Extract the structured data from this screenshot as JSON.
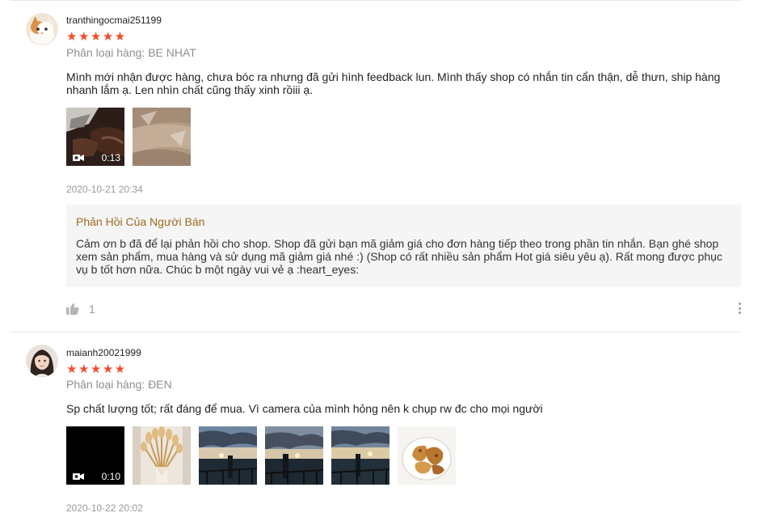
{
  "reviews": [
    {
      "username": "tranthingocmai251199",
      "rating_stars": "★★★★★",
      "rating": 5,
      "variation": "Phân loại hàng: BE NHAT",
      "comment": "Mình mới nhận được hàng, chưa bóc ra nhưng đã gửi hình feedback lun. Mình thấy shop có nhắn tin cẩn thận, dễ thưn, ship hàng nhanh lắm ạ. Len nhìn chất cũng thấy xinh rồiii ạ.",
      "media": [
        {
          "type": "video",
          "duration": "0:13",
          "icon": "video-camera-icon"
        },
        {
          "type": "image"
        }
      ],
      "timestamp": "2020-10-21 20:34",
      "seller_reply": {
        "title": "Phản Hồi Của Người Bán",
        "text": "Cảm ơn b đã để lại phản hồi cho shop. Shop đã gửi bạn mã giảm giá cho đơn hàng tiếp theo trong phần tin nhắn. Bạn ghé shop xem sản phẩm, mua hàng và sử dụng mã giảm giá nhé :) (Shop có rất nhiều sản phẩm Hot giá siêu yêu ạ). Rất mong được phục vụ b tốt hơn nữa. Chúc b một ngày vui vẻ ạ :heart_eyes:"
      },
      "likes": "1",
      "like_icon": "thumbs-up-icon",
      "more_icon": "more-vertical-icon"
    },
    {
      "username": "maianh20021999",
      "rating_stars": "★★★★★",
      "rating": 5,
      "variation": "Phân loại hàng: ĐEN",
      "comment": "Sp chất lượng tốt; rất đáng để mua. Vì camera của mình hỏng nên k chụp rw đc cho mọi người",
      "media": [
        {
          "type": "video",
          "duration": "0:10",
          "icon": "video-camera-icon"
        },
        {
          "type": "image"
        },
        {
          "type": "image"
        },
        {
          "type": "image"
        },
        {
          "type": "image"
        },
        {
          "type": "image"
        }
      ],
      "timestamp": "2020-10-22 20:02"
    }
  ],
  "colors": {
    "star": "#ee4d2d",
    "seller_title": "#9a6b1e",
    "muted": "#8f8f8f",
    "reply_bg": "#f5f5f5"
  }
}
